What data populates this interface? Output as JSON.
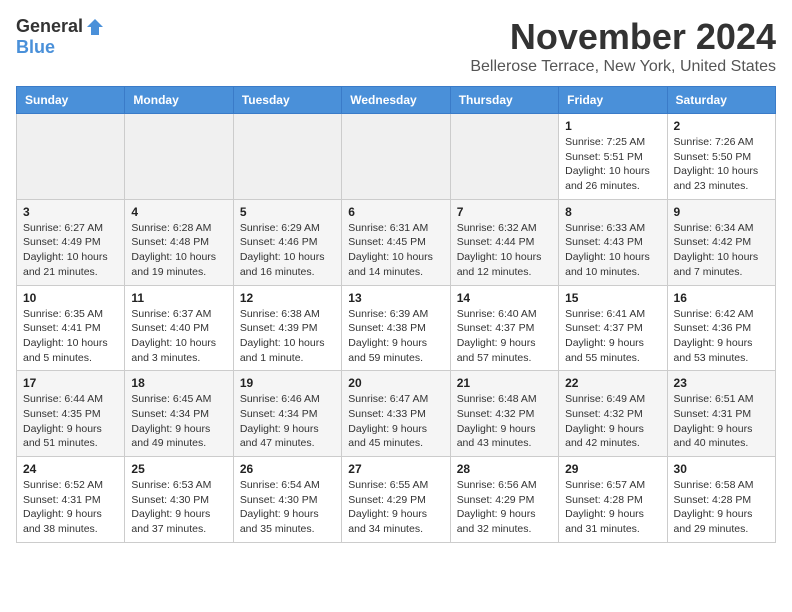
{
  "logo": {
    "general": "General",
    "blue": "Blue"
  },
  "title": "November 2024",
  "location": "Bellerose Terrace, New York, United States",
  "days_header": [
    "Sunday",
    "Monday",
    "Tuesday",
    "Wednesday",
    "Thursday",
    "Friday",
    "Saturday"
  ],
  "weeks": [
    [
      {
        "day": "",
        "info": ""
      },
      {
        "day": "",
        "info": ""
      },
      {
        "day": "",
        "info": ""
      },
      {
        "day": "",
        "info": ""
      },
      {
        "day": "",
        "info": ""
      },
      {
        "day": "1",
        "info": "Sunrise: 7:25 AM\nSunset: 5:51 PM\nDaylight: 10 hours and 26 minutes."
      },
      {
        "day": "2",
        "info": "Sunrise: 7:26 AM\nSunset: 5:50 PM\nDaylight: 10 hours and 23 minutes."
      }
    ],
    [
      {
        "day": "3",
        "info": "Sunrise: 6:27 AM\nSunset: 4:49 PM\nDaylight: 10 hours and 21 minutes."
      },
      {
        "day": "4",
        "info": "Sunrise: 6:28 AM\nSunset: 4:48 PM\nDaylight: 10 hours and 19 minutes."
      },
      {
        "day": "5",
        "info": "Sunrise: 6:29 AM\nSunset: 4:46 PM\nDaylight: 10 hours and 16 minutes."
      },
      {
        "day": "6",
        "info": "Sunrise: 6:31 AM\nSunset: 4:45 PM\nDaylight: 10 hours and 14 minutes."
      },
      {
        "day": "7",
        "info": "Sunrise: 6:32 AM\nSunset: 4:44 PM\nDaylight: 10 hours and 12 minutes."
      },
      {
        "day": "8",
        "info": "Sunrise: 6:33 AM\nSunset: 4:43 PM\nDaylight: 10 hours and 10 minutes."
      },
      {
        "day": "9",
        "info": "Sunrise: 6:34 AM\nSunset: 4:42 PM\nDaylight: 10 hours and 7 minutes."
      }
    ],
    [
      {
        "day": "10",
        "info": "Sunrise: 6:35 AM\nSunset: 4:41 PM\nDaylight: 10 hours and 5 minutes."
      },
      {
        "day": "11",
        "info": "Sunrise: 6:37 AM\nSunset: 4:40 PM\nDaylight: 10 hours and 3 minutes."
      },
      {
        "day": "12",
        "info": "Sunrise: 6:38 AM\nSunset: 4:39 PM\nDaylight: 10 hours and 1 minute."
      },
      {
        "day": "13",
        "info": "Sunrise: 6:39 AM\nSunset: 4:38 PM\nDaylight: 9 hours and 59 minutes."
      },
      {
        "day": "14",
        "info": "Sunrise: 6:40 AM\nSunset: 4:37 PM\nDaylight: 9 hours and 57 minutes."
      },
      {
        "day": "15",
        "info": "Sunrise: 6:41 AM\nSunset: 4:37 PM\nDaylight: 9 hours and 55 minutes."
      },
      {
        "day": "16",
        "info": "Sunrise: 6:42 AM\nSunset: 4:36 PM\nDaylight: 9 hours and 53 minutes."
      }
    ],
    [
      {
        "day": "17",
        "info": "Sunrise: 6:44 AM\nSunset: 4:35 PM\nDaylight: 9 hours and 51 minutes."
      },
      {
        "day": "18",
        "info": "Sunrise: 6:45 AM\nSunset: 4:34 PM\nDaylight: 9 hours and 49 minutes."
      },
      {
        "day": "19",
        "info": "Sunrise: 6:46 AM\nSunset: 4:34 PM\nDaylight: 9 hours and 47 minutes."
      },
      {
        "day": "20",
        "info": "Sunrise: 6:47 AM\nSunset: 4:33 PM\nDaylight: 9 hours and 45 minutes."
      },
      {
        "day": "21",
        "info": "Sunrise: 6:48 AM\nSunset: 4:32 PM\nDaylight: 9 hours and 43 minutes."
      },
      {
        "day": "22",
        "info": "Sunrise: 6:49 AM\nSunset: 4:32 PM\nDaylight: 9 hours and 42 minutes."
      },
      {
        "day": "23",
        "info": "Sunrise: 6:51 AM\nSunset: 4:31 PM\nDaylight: 9 hours and 40 minutes."
      }
    ],
    [
      {
        "day": "24",
        "info": "Sunrise: 6:52 AM\nSunset: 4:31 PM\nDaylight: 9 hours and 38 minutes."
      },
      {
        "day": "25",
        "info": "Sunrise: 6:53 AM\nSunset: 4:30 PM\nDaylight: 9 hours and 37 minutes."
      },
      {
        "day": "26",
        "info": "Sunrise: 6:54 AM\nSunset: 4:30 PM\nDaylight: 9 hours and 35 minutes."
      },
      {
        "day": "27",
        "info": "Sunrise: 6:55 AM\nSunset: 4:29 PM\nDaylight: 9 hours and 34 minutes."
      },
      {
        "day": "28",
        "info": "Sunrise: 6:56 AM\nSunset: 4:29 PM\nDaylight: 9 hours and 32 minutes."
      },
      {
        "day": "29",
        "info": "Sunrise: 6:57 AM\nSunset: 4:28 PM\nDaylight: 9 hours and 31 minutes."
      },
      {
        "day": "30",
        "info": "Sunrise: 6:58 AM\nSunset: 4:28 PM\nDaylight: 9 hours and 29 minutes."
      }
    ]
  ]
}
